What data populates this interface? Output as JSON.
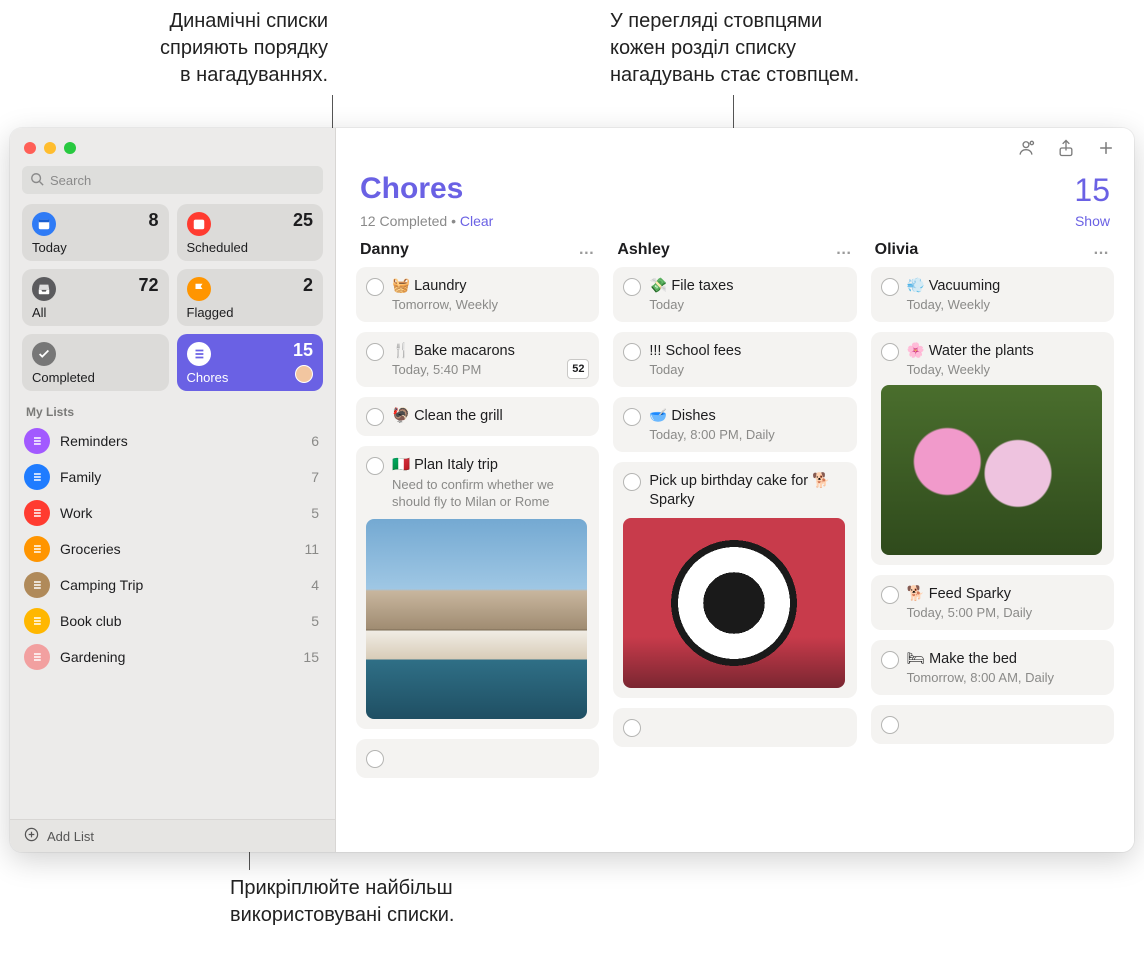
{
  "callouts": {
    "top_left": "Динамічні списки\nсприяють порядку\nв нагадуваннях.",
    "top_right": "У перегляді стовпцями\nкожен розділ списку\nнагадувань стає стовпцем.",
    "bottom": "Прикріплюйте найбільш\nвикористовувані списки."
  },
  "sidebar": {
    "search_placeholder": "Search",
    "smart": [
      {
        "key": "today",
        "label": "Today",
        "count": 8,
        "icon_bg": "#2f7bf6"
      },
      {
        "key": "scheduled",
        "label": "Scheduled",
        "count": 25,
        "icon_bg": "#ff3b30"
      },
      {
        "key": "all",
        "label": "All",
        "count": 72,
        "icon_bg": "#5b5b5e"
      },
      {
        "key": "flagged",
        "label": "Flagged",
        "count": 2,
        "icon_bg": "#ff9500"
      },
      {
        "key": "completed",
        "label": "Completed",
        "count": "",
        "icon_bg": "#777"
      },
      {
        "key": "chores",
        "label": "Chores",
        "count": 15,
        "icon_bg": "#fff",
        "active": true
      }
    ],
    "section_label": "My Lists",
    "lists": [
      {
        "name": "Reminders",
        "count": 6,
        "color": "#a259ff"
      },
      {
        "name": "Family",
        "count": 7,
        "color": "#1f7cff"
      },
      {
        "name": "Work",
        "count": 5,
        "color": "#ff3b30"
      },
      {
        "name": "Groceries",
        "count": 11,
        "color": "#ff9500"
      },
      {
        "name": "Camping Trip",
        "count": 4,
        "color": "#b08a5a"
      },
      {
        "name": "Book club",
        "count": 5,
        "color": "#ffb700"
      },
      {
        "name": "Gardening",
        "count": 15,
        "color": "#f2a0a0"
      }
    ],
    "add_list": "Add List"
  },
  "main": {
    "title": "Chores",
    "count": 15,
    "completed_text": "12 Completed",
    "clear": "Clear",
    "show": "Show",
    "columns": [
      {
        "name": "Danny",
        "items": [
          {
            "title": "🧺 Laundry",
            "sub": "Tomorrow, Weekly"
          },
          {
            "title": "🍴 Bake macarons",
            "sub": "Today, 5:40 PM",
            "badge": "52"
          },
          {
            "title": "🦃 Clean the grill"
          },
          {
            "title": "🇮🇹 Plan Italy trip",
            "note": "Need to confirm whether we should fly to Milan or Rome",
            "image": "italy"
          }
        ]
      },
      {
        "name": "Ashley",
        "items": [
          {
            "title": "💸 File taxes",
            "sub": "Today"
          },
          {
            "title": "!!! School fees",
            "sub": "Today"
          },
          {
            "title": "🥣 Dishes",
            "sub": "Today, 8:00 PM, Daily"
          },
          {
            "title": "Pick up birthday cake for 🐕 Sparky",
            "image": "dog"
          }
        ]
      },
      {
        "name": "Olivia",
        "items": [
          {
            "title": "💨 Vacuuming",
            "sub": "Today, Weekly"
          },
          {
            "title": "🌸 Water the plants",
            "sub": "Today, Weekly",
            "image": "flower"
          },
          {
            "title": "🐕 Feed Sparky",
            "sub": "Today, 5:00 PM, Daily"
          },
          {
            "title": "🛏 Make the bed",
            "sub": "Tomorrow, 8:00 AM, Daily"
          }
        ]
      }
    ]
  }
}
